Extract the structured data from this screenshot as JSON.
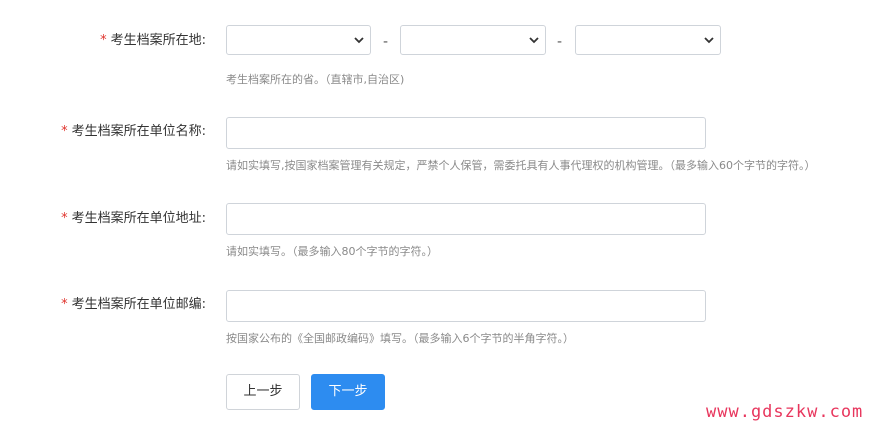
{
  "form": {
    "location": {
      "label": "考生档案所在地:",
      "selects": [
        {
          "value": "",
          "icon": "chevron-down-icon"
        },
        {
          "value": "",
          "icon": "chevron-down-icon"
        },
        {
          "value": "",
          "icon": "chevron-down-icon"
        }
      ],
      "separator": "-",
      "help": "考生档案所在的省。（直辖市,自治区)"
    },
    "unit_name": {
      "label": "考生档案所在单位名称:",
      "value": "",
      "help": "请如实填写,按国家档案管理有关规定，严禁个人保管，需委托具有人事代理权的机构管理。（最多输入60个字节的字符。）"
    },
    "unit_address": {
      "label": "考生档案所在单位地址:",
      "value": "",
      "help": "请如实填写。（最多输入80个字节的字符。）"
    },
    "unit_postcode": {
      "label": "考生档案所在单位邮编:",
      "value": "",
      "help": "按国家公布的《全国邮政编码》填写。（最多输入6个字节的半角字符。）"
    },
    "required_mark": "*"
  },
  "actions": {
    "prev_label": "上一步",
    "next_label": "下一步"
  },
  "watermark": "www.gdszkw.com",
  "colors": {
    "required": "#e0332c",
    "primary": "#2d8cf0",
    "watermark": "#e8365d",
    "help_text": "#8a8a8a"
  }
}
